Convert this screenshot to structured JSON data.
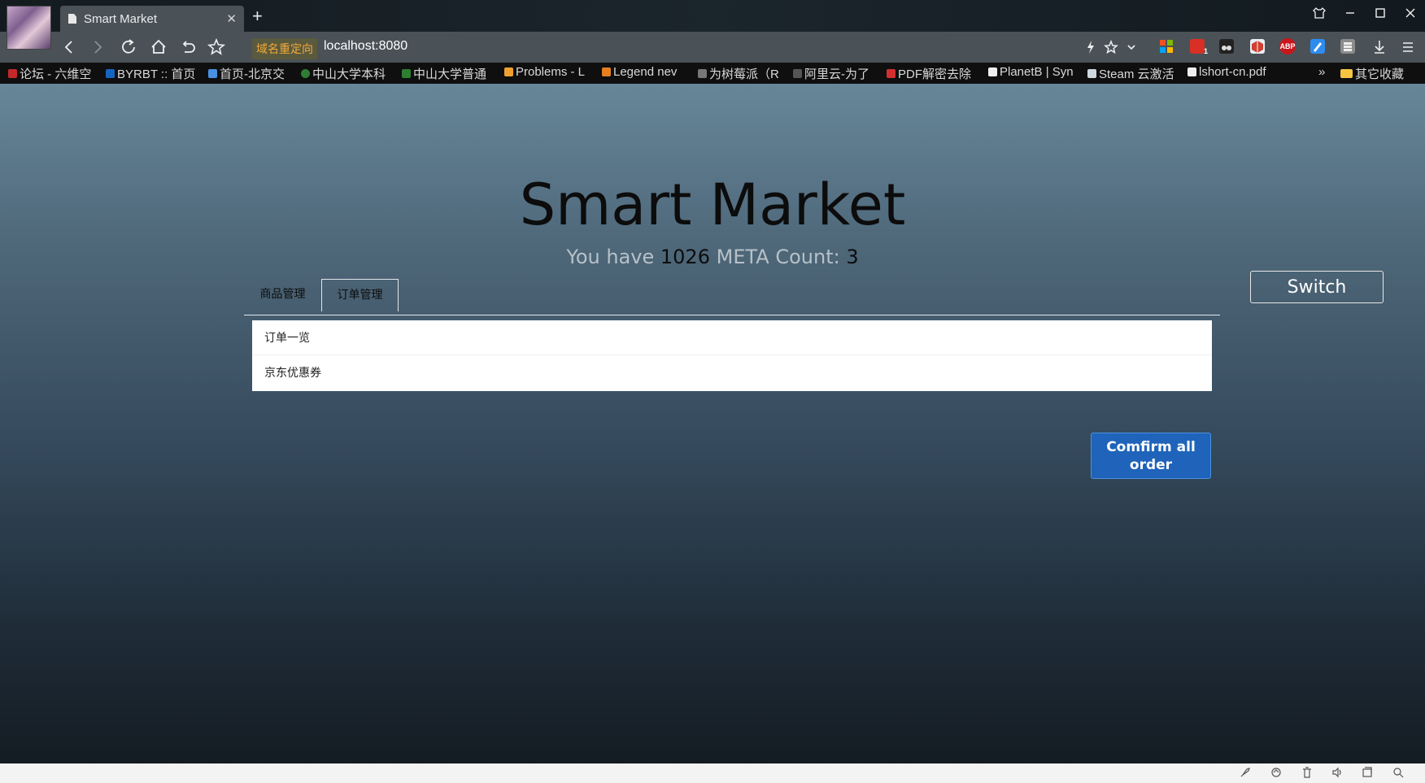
{
  "browser": {
    "tab_title": "Smart Market",
    "tab_close": "✕",
    "new_tab": "+",
    "redirect_label": "域名重定向",
    "url": "localhost:8080",
    "bookmarks": [
      "论坛 - 六维空",
      "BYRBT :: 首页",
      "首页-北京交",
      "中山大学本科",
      "中山大学普通",
      "Problems - L",
      "Legend nev",
      "为树莓派（R",
      "阿里云-为了",
      "PDF解密去除",
      "PlanetB | Syn",
      "Steam 云激活",
      "lshort-cn.pdf"
    ],
    "bookmarks_more": "»",
    "other_bookmarks": "其它收藏",
    "ext_badge": "1",
    "ext_abp": "ABP"
  },
  "page": {
    "title": "Smart Market",
    "balance_prefix": "You have",
    "balance": "1026",
    "balance_unit": "META",
    "count_label": "Count:",
    "count": "3",
    "switch_label": "Switch",
    "tabs": [
      {
        "label": "商品管理",
        "active": false
      },
      {
        "label": "订单管理",
        "active": true
      }
    ],
    "list_items": [
      "订单一览",
      "京东优惠券"
    ],
    "confirm_label": "Comfirm all order"
  },
  "colors": {
    "confirm_button": "#1f64ba",
    "title_text": "#0c0c0c",
    "subtitle_text": "#b6c1c8"
  }
}
